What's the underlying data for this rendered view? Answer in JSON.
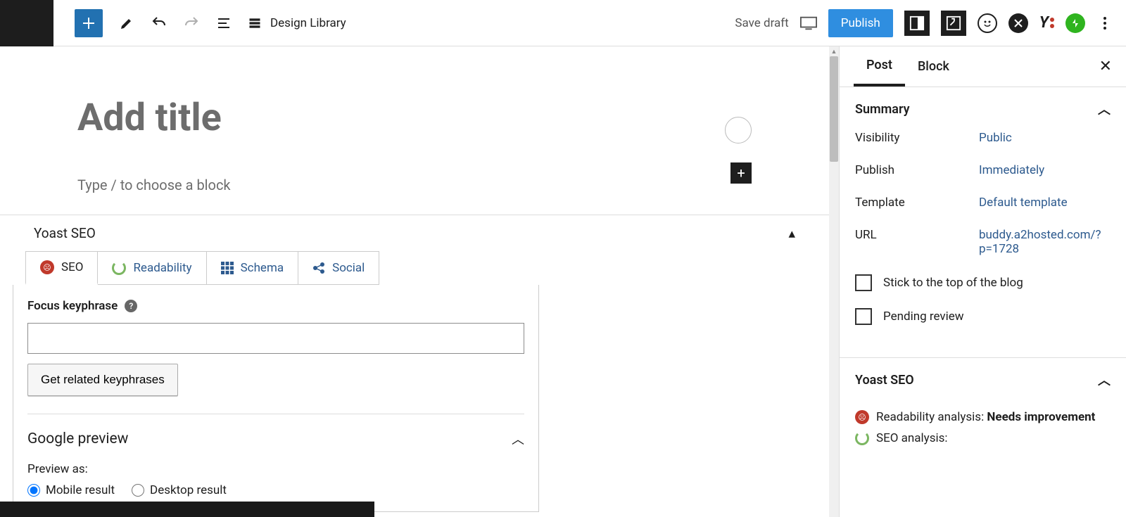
{
  "toolbar": {
    "design_library_label": "Design Library",
    "save_draft_label": "Save draft",
    "publish_label": "Publish"
  },
  "editor": {
    "title_placeholder": "Add title",
    "block_placeholder": "Type / to choose a block"
  },
  "yoast_metabox": {
    "heading": "Yoast SEO",
    "tabs": {
      "seo": "SEO",
      "readability": "Readability",
      "schema": "Schema",
      "social": "Social"
    },
    "focus_keyphrase_label": "Focus keyphrase",
    "focus_keyphrase_value": "",
    "related_btn": "Get related keyphrases",
    "google_preview_label": "Google preview",
    "preview_as_label": "Preview as:",
    "mobile_label": "Mobile result",
    "desktop_label": "Desktop result"
  },
  "sidebar": {
    "tabs": {
      "post": "Post",
      "block": "Block"
    },
    "summary": {
      "heading": "Summary",
      "visibility_label": "Visibility",
      "visibility_value": "Public",
      "publish_label": "Publish",
      "publish_value": "Immediately",
      "template_label": "Template",
      "template_value": "Default template",
      "url_label": "URL",
      "url_value": "buddy.a2hosted.com/?p=1728",
      "stick_label": "Stick to the top of the blog",
      "pending_label": "Pending review"
    },
    "yoast": {
      "heading": "Yoast SEO",
      "readability_label": "Readability analysis:",
      "readability_status": "Needs improvement",
      "seo_label": "SEO analysis:"
    }
  }
}
